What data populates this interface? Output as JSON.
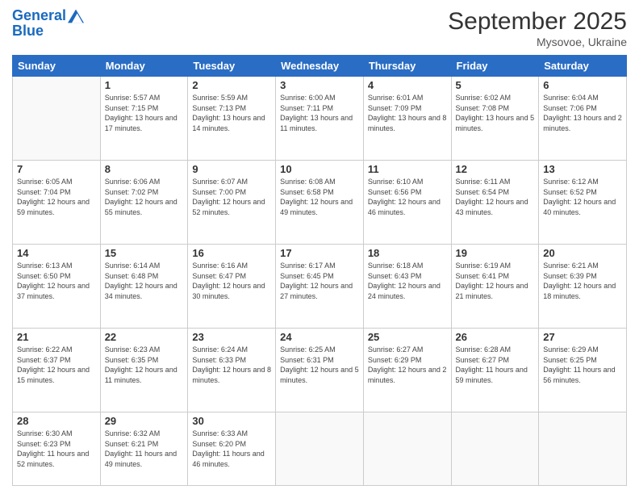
{
  "header": {
    "logo_line1": "General",
    "logo_line2": "Blue",
    "month_title": "September 2025",
    "location": "Mysovoe, Ukraine"
  },
  "days_of_week": [
    "Sunday",
    "Monday",
    "Tuesday",
    "Wednesday",
    "Thursday",
    "Friday",
    "Saturday"
  ],
  "weeks": [
    [
      {
        "day": "",
        "info": ""
      },
      {
        "day": "1",
        "info": "Sunrise: 5:57 AM\nSunset: 7:15 PM\nDaylight: 13 hours and 17 minutes."
      },
      {
        "day": "2",
        "info": "Sunrise: 5:59 AM\nSunset: 7:13 PM\nDaylight: 13 hours and 14 minutes."
      },
      {
        "day": "3",
        "info": "Sunrise: 6:00 AM\nSunset: 7:11 PM\nDaylight: 13 hours and 11 minutes."
      },
      {
        "day": "4",
        "info": "Sunrise: 6:01 AM\nSunset: 7:09 PM\nDaylight: 13 hours and 8 minutes."
      },
      {
        "day": "5",
        "info": "Sunrise: 6:02 AM\nSunset: 7:08 PM\nDaylight: 13 hours and 5 minutes."
      },
      {
        "day": "6",
        "info": "Sunrise: 6:04 AM\nSunset: 7:06 PM\nDaylight: 13 hours and 2 minutes."
      }
    ],
    [
      {
        "day": "7",
        "info": "Sunrise: 6:05 AM\nSunset: 7:04 PM\nDaylight: 12 hours and 59 minutes."
      },
      {
        "day": "8",
        "info": "Sunrise: 6:06 AM\nSunset: 7:02 PM\nDaylight: 12 hours and 55 minutes."
      },
      {
        "day": "9",
        "info": "Sunrise: 6:07 AM\nSunset: 7:00 PM\nDaylight: 12 hours and 52 minutes."
      },
      {
        "day": "10",
        "info": "Sunrise: 6:08 AM\nSunset: 6:58 PM\nDaylight: 12 hours and 49 minutes."
      },
      {
        "day": "11",
        "info": "Sunrise: 6:10 AM\nSunset: 6:56 PM\nDaylight: 12 hours and 46 minutes."
      },
      {
        "day": "12",
        "info": "Sunrise: 6:11 AM\nSunset: 6:54 PM\nDaylight: 12 hours and 43 minutes."
      },
      {
        "day": "13",
        "info": "Sunrise: 6:12 AM\nSunset: 6:52 PM\nDaylight: 12 hours and 40 minutes."
      }
    ],
    [
      {
        "day": "14",
        "info": "Sunrise: 6:13 AM\nSunset: 6:50 PM\nDaylight: 12 hours and 37 minutes."
      },
      {
        "day": "15",
        "info": "Sunrise: 6:14 AM\nSunset: 6:48 PM\nDaylight: 12 hours and 34 minutes."
      },
      {
        "day": "16",
        "info": "Sunrise: 6:16 AM\nSunset: 6:47 PM\nDaylight: 12 hours and 30 minutes."
      },
      {
        "day": "17",
        "info": "Sunrise: 6:17 AM\nSunset: 6:45 PM\nDaylight: 12 hours and 27 minutes."
      },
      {
        "day": "18",
        "info": "Sunrise: 6:18 AM\nSunset: 6:43 PM\nDaylight: 12 hours and 24 minutes."
      },
      {
        "day": "19",
        "info": "Sunrise: 6:19 AM\nSunset: 6:41 PM\nDaylight: 12 hours and 21 minutes."
      },
      {
        "day": "20",
        "info": "Sunrise: 6:21 AM\nSunset: 6:39 PM\nDaylight: 12 hours and 18 minutes."
      }
    ],
    [
      {
        "day": "21",
        "info": "Sunrise: 6:22 AM\nSunset: 6:37 PM\nDaylight: 12 hours and 15 minutes."
      },
      {
        "day": "22",
        "info": "Sunrise: 6:23 AM\nSunset: 6:35 PM\nDaylight: 12 hours and 11 minutes."
      },
      {
        "day": "23",
        "info": "Sunrise: 6:24 AM\nSunset: 6:33 PM\nDaylight: 12 hours and 8 minutes."
      },
      {
        "day": "24",
        "info": "Sunrise: 6:25 AM\nSunset: 6:31 PM\nDaylight: 12 hours and 5 minutes."
      },
      {
        "day": "25",
        "info": "Sunrise: 6:27 AM\nSunset: 6:29 PM\nDaylight: 12 hours and 2 minutes."
      },
      {
        "day": "26",
        "info": "Sunrise: 6:28 AM\nSunset: 6:27 PM\nDaylight: 11 hours and 59 minutes."
      },
      {
        "day": "27",
        "info": "Sunrise: 6:29 AM\nSunset: 6:25 PM\nDaylight: 11 hours and 56 minutes."
      }
    ],
    [
      {
        "day": "28",
        "info": "Sunrise: 6:30 AM\nSunset: 6:23 PM\nDaylight: 11 hours and 52 minutes."
      },
      {
        "day": "29",
        "info": "Sunrise: 6:32 AM\nSunset: 6:21 PM\nDaylight: 11 hours and 49 minutes."
      },
      {
        "day": "30",
        "info": "Sunrise: 6:33 AM\nSunset: 6:20 PM\nDaylight: 11 hours and 46 minutes."
      },
      {
        "day": "",
        "info": ""
      },
      {
        "day": "",
        "info": ""
      },
      {
        "day": "",
        "info": ""
      },
      {
        "day": "",
        "info": ""
      }
    ]
  ]
}
